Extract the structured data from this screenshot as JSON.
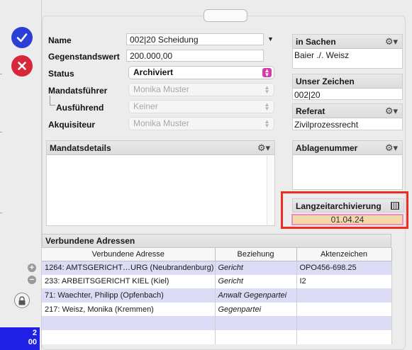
{
  "form": {
    "name_label": "Name",
    "name_value": "002|20 Scheidung",
    "gegenstandswert_label": "Gegenstandswert",
    "gegenstandswert_value": "200.000,00",
    "status_label": "Status",
    "status_value": "Archiviert",
    "mandatsfuehrer_label": "Mandatsführer",
    "mandatsfuehrer_value": "Monika Muster",
    "ausfuehrend_label": "Ausführend",
    "ausfuehrend_value": "Keiner",
    "akquisiteur_label": "Akquisiteur",
    "akquisiteur_value": "Monika Muster"
  },
  "panels": {
    "mandatsdetails": {
      "title": "Mandatsdetails",
      "content": ""
    },
    "in_sachen": {
      "title": "in Sachen",
      "content": "Baier ./. Weisz"
    },
    "unser_zeichen": {
      "title": "Unser Zeichen",
      "content": "002|20"
    },
    "referat": {
      "title": "Referat",
      "content": "Zivilprozessrecht"
    },
    "ablagenummer": {
      "title": "Ablagenummer",
      "content": ""
    },
    "langzeitarchivierung": {
      "title": "Langzeitarchivierung",
      "value": "01.04.24"
    }
  },
  "addresses": {
    "title": "Verbundene Adressen",
    "columns": [
      "Verbundene Adresse",
      "Beziehung",
      "Aktenzeichen"
    ],
    "rows": [
      {
        "adresse": "1264: AMTSGERICHT…URG (Neubrandenburg)",
        "beziehung": "Gericht",
        "aktenzeichen": "OPO456-698.25"
      },
      {
        "adresse": "233: ARBEITSGERICHT KIEL (Kiel)",
        "beziehung": "Gericht",
        "aktenzeichen": "I2"
      },
      {
        "adresse": "71: Waechter, Philipp (Opfenbach)",
        "beziehung": "Anwalt Gegenpartei",
        "aktenzeichen": ""
      },
      {
        "adresse": "217: Weisz, Monika (Kremmen)",
        "beziehung": "Gegenpartei",
        "aktenzeichen": ""
      },
      {
        "adresse": "",
        "beziehung": "",
        "aktenzeichen": ""
      },
      {
        "adresse": "",
        "beziehung": "",
        "aktenzeichen": ""
      }
    ]
  },
  "sidebar": {
    "badge_line1": "2",
    "badge_line2": "00",
    "add_symbol": "+",
    "remove_symbol": "−"
  },
  "icons": {
    "ok": "checkmark-icon",
    "cancel": "x-icon",
    "lock": "lock-icon",
    "gear": "gear-icon",
    "calendar": "calendar-icon"
  },
  "colors": {
    "ok_button": "#2b3ed6",
    "cancel_button": "#d8263a",
    "highlight_border": "#ec2d22",
    "date_field_bg": "#f6d7a9",
    "badge_bg": "#1f1fe6",
    "row_stripe": "#dcdcf7"
  }
}
